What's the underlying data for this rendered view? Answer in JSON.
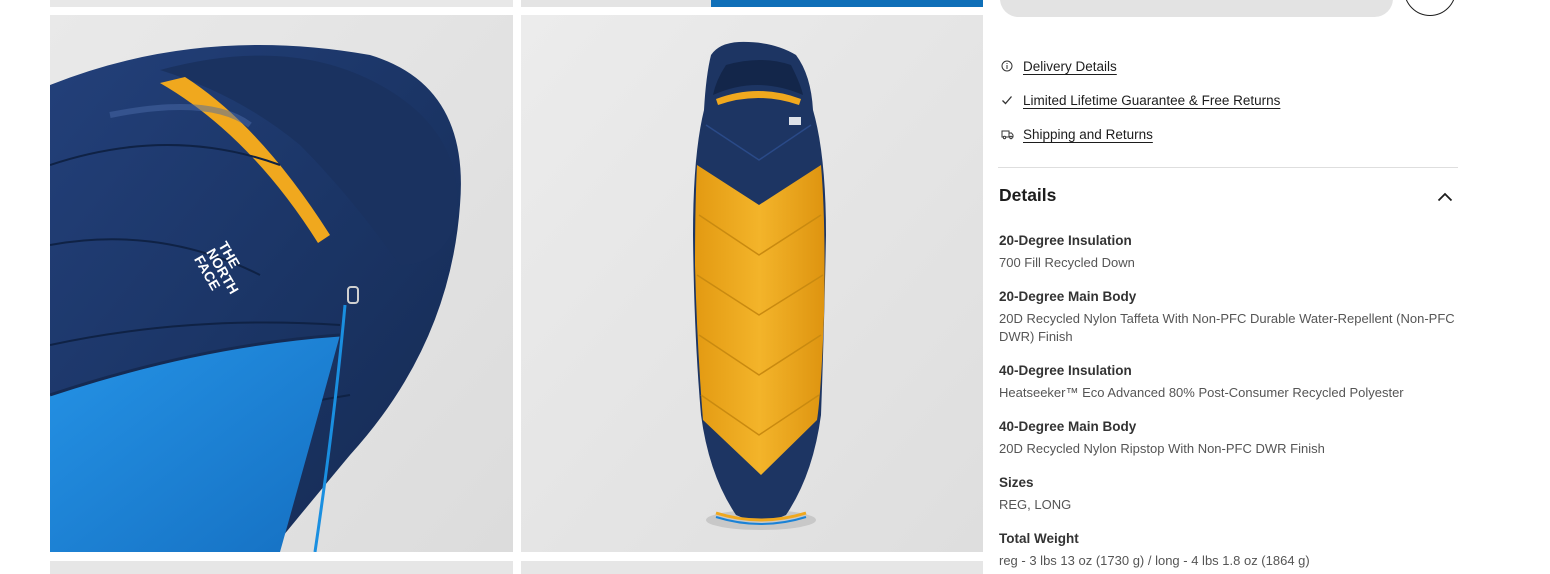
{
  "links": [
    {
      "label": "Delivery Details",
      "icon": "info-circle-icon"
    },
    {
      "label": "Limited Lifetime Guarantee & Free Returns",
      "icon": "checkmark-icon"
    },
    {
      "label": "Shipping and Returns",
      "icon": "truck-icon"
    }
  ],
  "details": {
    "title": "Details",
    "specs": [
      {
        "label": "20-Degree Insulation",
        "value": "700 Fill Recycled Down"
      },
      {
        "label": "20-Degree Main Body",
        "value": "20D Recycled Nylon Taffeta With Non-PFC Durable Water-Repellent (Non-PFC DWR) Finish"
      },
      {
        "label": "40-Degree Insulation",
        "value": "Heatseeker™ Eco Advanced 80% Post-Consumer Recycled Polyester"
      },
      {
        "label": "40-Degree Main Body",
        "value": "20D Recycled Nylon Ripstop With Non-PFC DWR Finish"
      },
      {
        "label": "Sizes",
        "value": "REG, LONG"
      },
      {
        "label": "Total Weight",
        "value": "reg - 3 lbs 13 oz (1730 g) / long - 4 lbs 1.8 oz (1864 g)"
      }
    ]
  },
  "images": {
    "logo_text": "THE NORTH FACE"
  },
  "colors": {
    "navy": "#1d3563",
    "yellow": "#f0a81e",
    "bright_blue": "#1a82d6",
    "background_gray": "#e6e6e6"
  }
}
